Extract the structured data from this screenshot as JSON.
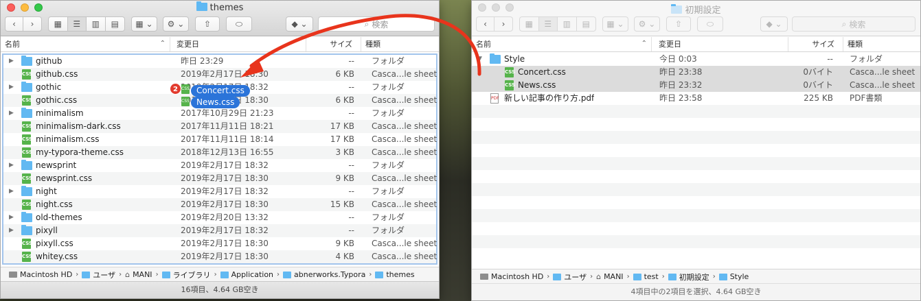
{
  "left_window": {
    "title": "themes",
    "search_placeholder": "検索",
    "columns": [
      "名前",
      "変更日",
      "サイズ",
      "種類"
    ],
    "rows": [
      {
        "name": "github",
        "date": "昨日 23:29",
        "size": "--",
        "kind": "フォルダ",
        "type": "folder"
      },
      {
        "name": "github.css",
        "date": "2019年2月17日 18:30",
        "size": "6 KB",
        "kind": "Casca...le sheet",
        "type": "css"
      },
      {
        "name": "gothic",
        "date": "2019年2月17日 18:32",
        "size": "--",
        "kind": "フォルダ",
        "type": "folder"
      },
      {
        "name": "gothic.css",
        "date": "2019年2月17日 18:30",
        "size": "6 KB",
        "kind": "Casca...le sheet",
        "type": "css"
      },
      {
        "name": "minimalism",
        "date": "2017年10月29日 21:23",
        "size": "--",
        "kind": "フォルダ",
        "type": "folder"
      },
      {
        "name": "minimalism-dark.css",
        "date": "2017年11月11日 18:21",
        "size": "17 KB",
        "kind": "Casca...le sheet",
        "type": "css"
      },
      {
        "name": "minimalism.css",
        "date": "2017年11月11日 18:14",
        "size": "17 KB",
        "kind": "Casca...le sheet",
        "type": "css"
      },
      {
        "name": "my-typora-theme.css",
        "date": "2018年12月13日 16:55",
        "size": "3 KB",
        "kind": "Casca...le sheet",
        "type": "css"
      },
      {
        "name": "newsprint",
        "date": "2019年2月17日 18:32",
        "size": "--",
        "kind": "フォルダ",
        "type": "folder"
      },
      {
        "name": "newsprint.css",
        "date": "2019年2月17日 18:30",
        "size": "9 KB",
        "kind": "Casca...le sheet",
        "type": "css"
      },
      {
        "name": "night",
        "date": "2019年2月17日 18:32",
        "size": "--",
        "kind": "フォルダ",
        "type": "folder"
      },
      {
        "name": "night.css",
        "date": "2019年2月17日 18:30",
        "size": "15 KB",
        "kind": "Casca...le sheet",
        "type": "css"
      },
      {
        "name": "old-themes",
        "date": "2019年2月20日 13:32",
        "size": "--",
        "kind": "フォルダ",
        "type": "folder"
      },
      {
        "name": "pixyll",
        "date": "2019年2月17日 18:32",
        "size": "--",
        "kind": "フォルダ",
        "type": "folder"
      },
      {
        "name": "pixyll.css",
        "date": "2019年2月17日 18:30",
        "size": "9 KB",
        "kind": "Casca...le sheet",
        "type": "css"
      },
      {
        "name": "whitey.css",
        "date": "2019年2月17日 18:30",
        "size": "4 KB",
        "kind": "Casca...le sheet",
        "type": "css"
      }
    ],
    "path": [
      "Macintosh HD",
      "ユーザ",
      "MANI",
      "ライブラリ",
      "Application",
      "abnerworks.Typora",
      "themes"
    ],
    "status": "16項目、4.64 GB空き"
  },
  "drag": {
    "count": "2",
    "items": [
      "Concert.css",
      "News.css"
    ]
  },
  "right_window": {
    "title": "初期設定",
    "search_placeholder": "検索",
    "columns": [
      "名前",
      "変更日",
      "サイズ",
      "種類"
    ],
    "rows": [
      {
        "name": "Style",
        "date": "今日 0:03",
        "size": "--",
        "kind": "フォルダ",
        "type": "folder"
      },
      {
        "name": "Concert.css",
        "date": "昨日 23:38",
        "size": "0バイト",
        "kind": "Casca...le sheet",
        "type": "css"
      },
      {
        "name": "News.css",
        "date": "昨日 23:32",
        "size": "0バイト",
        "kind": "Casca...le sheet",
        "type": "css"
      },
      {
        "name": "新しい記事の作り方.pdf",
        "date": "昨日 23:58",
        "size": "225 KB",
        "kind": "PDF書類",
        "type": "pdf"
      }
    ],
    "path": [
      "Macintosh HD",
      "ユーザ",
      "MANI",
      "test",
      "初期設定",
      "Style"
    ],
    "status": "4項目中の2項目を選択、4.64 GB空き"
  },
  "colors": {
    "arrow": "#e8341c",
    "selection": "#dcdcdc",
    "drop_highlight": "#a2c4ec",
    "drag_chip": "#2b74d9",
    "folder": "#62b9f2",
    "css_icon": "#56b34b"
  }
}
